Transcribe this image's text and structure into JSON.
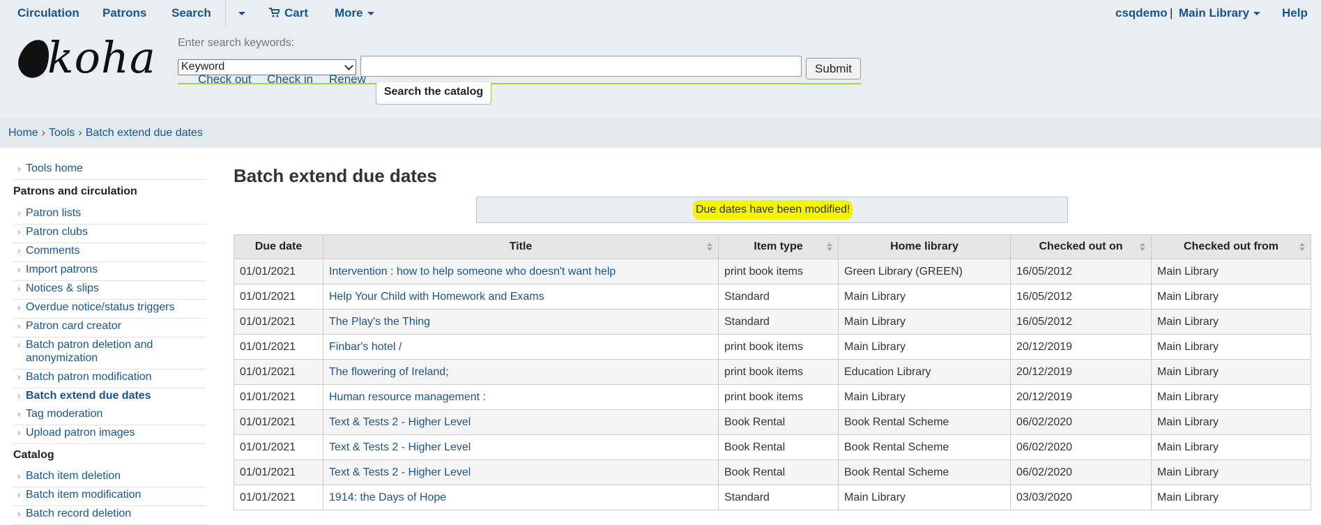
{
  "topnav": {
    "circulation": "Circulation",
    "patrons": "Patrons",
    "search": "Search",
    "cart": "Cart",
    "more": "More",
    "user": "csqdemo",
    "user_sep": "|",
    "library": "Main Library",
    "help": "Help"
  },
  "logo": {
    "text": "koha"
  },
  "search": {
    "label": "Enter search keywords:",
    "type_value": "Keyword",
    "query_value": "",
    "submit_label": "Submit"
  },
  "quick_tabs": [
    "Check out",
    "Check in",
    "Renew",
    "Search the catalog"
  ],
  "breadcrumbs": [
    "Home",
    "Tools",
    "Batch extend due dates"
  ],
  "sidebar": {
    "tools_home": "Tools home",
    "section_patrons": "Patrons and circulation",
    "patron_items": [
      "Patron lists",
      "Patron clubs",
      "Comments",
      "Import patrons",
      "Notices & slips",
      "Overdue notice/status triggers",
      "Patron card creator",
      "Batch patron deletion and anonymization",
      "Batch patron modification",
      "Batch extend due dates",
      "Tag moderation",
      "Upload patron images"
    ],
    "section_catalog": "Catalog",
    "catalog_items": [
      "Batch item deletion",
      "Batch item modification",
      "Batch record deletion"
    ]
  },
  "main": {
    "title": "Batch extend due dates",
    "message": "Due dates have been modified!"
  },
  "table": {
    "headers": [
      "Due date",
      "Title",
      "Item type",
      "Home library",
      "Checked out on",
      "Checked out from"
    ],
    "rows": [
      [
        "01/01/2021",
        "Intervention : how to help someone who doesn't want help",
        "print book items",
        "Green Library (GREEN)",
        "16/05/2012",
        "Main Library"
      ],
      [
        "01/01/2021",
        "Help Your Child with Homework and Exams",
        "Standard",
        "Main Library",
        "16/05/2012",
        "Main Library"
      ],
      [
        "01/01/2021",
        "The Play's the Thing",
        "Standard",
        "Main Library",
        "16/05/2012",
        "Main Library"
      ],
      [
        "01/01/2021",
        "Finbar's hotel /",
        "print book items",
        "Main Library",
        "20/12/2019",
        "Main Library"
      ],
      [
        "01/01/2021",
        "The flowering of Ireland;",
        "print book items",
        "Education Library",
        "20/12/2019",
        "Main Library"
      ],
      [
        "01/01/2021",
        "Human resource management :",
        "print book items",
        "Main Library",
        "20/12/2019",
        "Main Library"
      ],
      [
        "01/01/2021",
        "Text & Tests 2 - Higher Level",
        "Book Rental",
        "Book Rental Scheme",
        "06/02/2020",
        "Main Library"
      ],
      [
        "01/01/2021",
        "Text & Tests 2 - Higher Level",
        "Book Rental",
        "Book Rental Scheme",
        "06/02/2020",
        "Main Library"
      ],
      [
        "01/01/2021",
        "Text & Tests 2 - Higher Level",
        "Book Rental",
        "Book Rental Scheme",
        "06/02/2020",
        "Main Library"
      ],
      [
        "01/01/2021",
        "1914: the Days of Hope",
        "Standard",
        "Main Library",
        "03/03/2020",
        "Main Library"
      ]
    ]
  },
  "colors": {
    "link": "#1a5490",
    "header_bg": "#e8eef2",
    "highlight": "#f4f400",
    "tab_accent": "#a8cf45"
  }
}
